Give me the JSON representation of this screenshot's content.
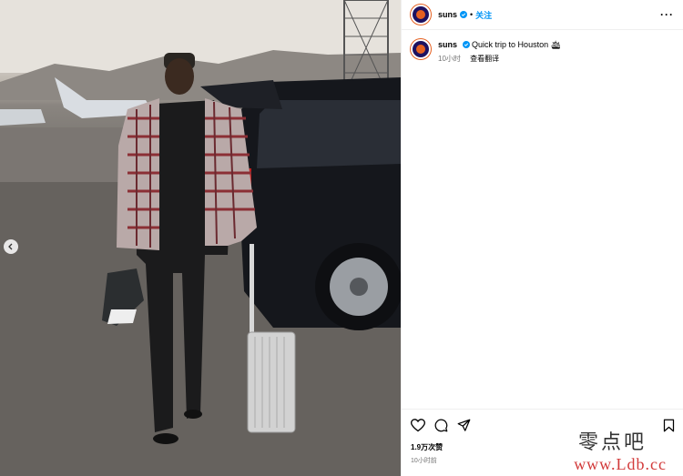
{
  "post": {
    "account": "suns",
    "follow_label": "关注",
    "more_label": "···",
    "caption_text": "Quick trip to Houston",
    "caption_emoji": "🛳",
    "time_ago": "10小时",
    "translate_label": "查看翻译",
    "likes": "1.9万次赞",
    "posted_ago": "10小时前"
  },
  "icons": {
    "like": "heart-icon",
    "comment": "comment-icon",
    "share": "share-icon",
    "save": "bookmark-icon",
    "prev": "chevron-left-icon",
    "verified": "verified-badge-icon"
  },
  "colors": {
    "accent_blue": "#0095f6",
    "brand_purple": "#1d1160",
    "brand_orange": "#e56020",
    "watermark_red": "#d23a3a"
  },
  "watermark": {
    "cn": "零点吧",
    "url": "www.Ldb.cc"
  }
}
